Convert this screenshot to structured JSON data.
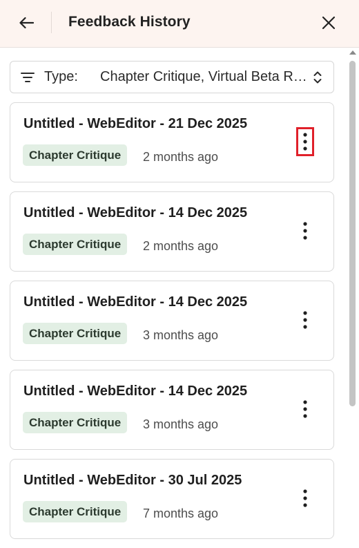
{
  "header": {
    "title": "Feedback History"
  },
  "filter": {
    "label": "Type:",
    "value": "Chapter Critique, Virtual Beta Readers"
  },
  "items": [
    {
      "title": "Untitled - WebEditor - 21 Dec 2025",
      "badge": "Chapter Critique",
      "time": "2 months ago"
    },
    {
      "title": "Untitled - WebEditor - 14 Dec 2025",
      "badge": "Chapter Critique",
      "time": "2 months ago"
    },
    {
      "title": "Untitled - WebEditor - 14 Dec 2025",
      "badge": "Chapter Critique",
      "time": "3 months ago"
    },
    {
      "title": "Untitled - WebEditor - 14 Dec 2025",
      "badge": "Chapter Critique",
      "time": "3 months ago"
    },
    {
      "title": "Untitled - WebEditor - 30 Jul 2025",
      "badge": "Chapter Critique",
      "time": "7 months ago"
    }
  ],
  "colors": {
    "header_bg": "#fdf4f0",
    "badge_bg": "#e2efe4",
    "highlight": "#e0202a"
  },
  "icons": {
    "back": "arrow-left-icon",
    "close": "close-icon",
    "filter": "filter-lines-icon",
    "chevron": "chevron-up-down-icon",
    "more": "more-vertical-icon"
  }
}
